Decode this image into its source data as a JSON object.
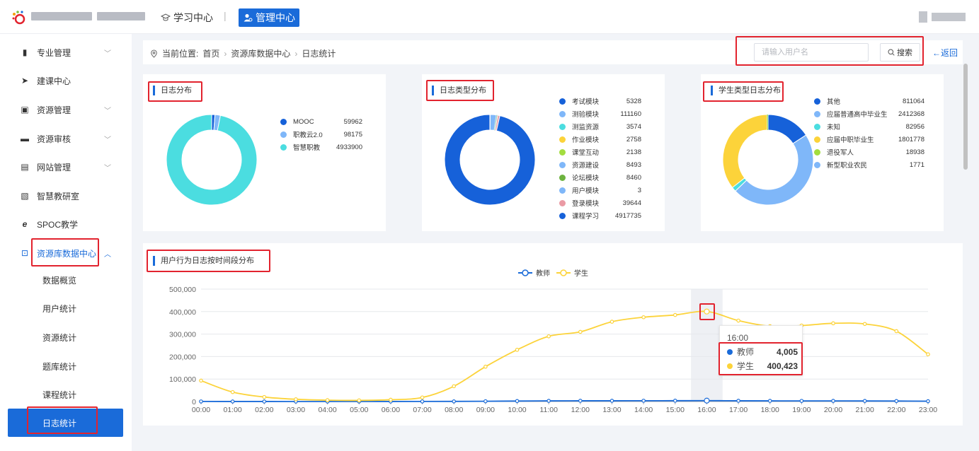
{
  "header": {
    "nav_study": "学习中心",
    "nav_admin": "管理中心"
  },
  "sidebar": {
    "items": [
      {
        "label": "专业管理",
        "icon": "book-icon",
        "expandable": true
      },
      {
        "label": "建课中心",
        "icon": "send-icon",
        "expandable": false
      },
      {
        "label": "资源管理",
        "icon": "box-icon",
        "expandable": true
      },
      {
        "label": "资源审核",
        "icon": "folder-icon",
        "expandable": true
      },
      {
        "label": "网站管理",
        "icon": "monitor-icon",
        "expandable": true
      },
      {
        "label": "智慧教研室",
        "icon": "document-icon",
        "expandable": false
      },
      {
        "label": "SPOC教学",
        "icon": "browser-icon",
        "expandable": false
      },
      {
        "label": "资源库数据中心",
        "icon": "data-icon",
        "expandable": true,
        "active": true
      }
    ],
    "sub_items": [
      {
        "label": "数据概览"
      },
      {
        "label": "用户统计"
      },
      {
        "label": "资源统计"
      },
      {
        "label": "题库统计"
      },
      {
        "label": "课程统计"
      },
      {
        "label": "日志统计",
        "active": true
      }
    ]
  },
  "breadcrumb": {
    "prefix": "当前位置:",
    "items": [
      "首页",
      "资源库数据中心",
      "日志统计"
    ]
  },
  "search": {
    "placeholder": "请输入用户名",
    "value": "",
    "button_label": "搜索"
  },
  "back_label": "←返回",
  "colors": {
    "accent": "#1a6bd9",
    "highlight_box": "#e2232e",
    "teacher": "#1a6bd9",
    "student": "#fcd33a"
  },
  "cards": {
    "log_dist": {
      "title": "日志分布",
      "items": [
        {
          "name": "MOOC",
          "value": "59962",
          "color": "#1661d9"
        },
        {
          "name": "职教云2.0",
          "value": "98175",
          "color": "#7fb7f9"
        },
        {
          "name": "智慧职教",
          "value": "4933900",
          "color": "#4bdde0"
        }
      ]
    },
    "log_type_dist": {
      "title": "日志类型分布",
      "items": [
        {
          "name": "考试模块",
          "value": "5328",
          "color": "#1661d9"
        },
        {
          "name": "测验模块",
          "value": "111160",
          "color": "#7fb7f9"
        },
        {
          "name": "测监资源",
          "value": "3574",
          "color": "#4bdde0"
        },
        {
          "name": "作业模块",
          "value": "2758",
          "color": "#fcd33a"
        },
        {
          "name": "课堂互动",
          "value": "2138",
          "color": "#a3dd3f"
        },
        {
          "name": "资源建设",
          "value": "8493",
          "color": "#7fb7f9"
        },
        {
          "name": "论坛模块",
          "value": "8460",
          "color": "#6db33f"
        },
        {
          "name": "用户模块",
          "value": "3",
          "color": "#7fb7f9"
        },
        {
          "name": "登录模块",
          "value": "39644",
          "color": "#ea9aa4"
        },
        {
          "name": "课程学习",
          "value": "4917735",
          "color": "#1661d9"
        }
      ]
    },
    "student_type_dist": {
      "title": "学生类型日志分布",
      "items": [
        {
          "name": "其他",
          "value": "811064",
          "color": "#1661d9"
        },
        {
          "name": "应届普通高中毕业生",
          "value": "2412368",
          "color": "#7fb7f9"
        },
        {
          "name": "未知",
          "value": "82956",
          "color": "#4bdde0"
        },
        {
          "name": "应届中职毕业生",
          "value": "1801778",
          "color": "#fcd33a"
        },
        {
          "name": "退役军人",
          "value": "18938",
          "color": "#a3dd3f"
        },
        {
          "name": "新型职业农民",
          "value": "1771",
          "color": "#7fb7f9"
        }
      ]
    }
  },
  "chart_data": {
    "type": "line",
    "title": "用户行为日志按时间段分布",
    "x": [
      "00:00",
      "01:00",
      "02:00",
      "03:00",
      "04:00",
      "05:00",
      "06:00",
      "07:00",
      "08:00",
      "09:00",
      "10:00",
      "11:00",
      "12:00",
      "13:00",
      "14:00",
      "15:00",
      "16:00",
      "17:00",
      "18:00",
      "19:00",
      "20:00",
      "21:00",
      "22:00",
      "23:00"
    ],
    "series": [
      {
        "name": "教师",
        "color": "#1a6bd9",
        "values": [
          300,
          200,
          150,
          100,
          100,
          100,
          150,
          300,
          600,
          1200,
          2200,
          3000,
          3300,
          3400,
          3500,
          3700,
          4005,
          3300,
          2900,
          2700,
          2800,
          2600,
          2200,
          1400
        ]
      },
      {
        "name": "学生",
        "color": "#fcd33a",
        "values": [
          93000,
          42000,
          20000,
          10000,
          6000,
          5000,
          8000,
          18000,
          68000,
          155000,
          230000,
          290000,
          310000,
          355000,
          375000,
          385000,
          400423,
          360000,
          335000,
          338000,
          348000,
          345000,
          313000,
          210000
        ]
      }
    ],
    "yticks": [
      "500,000",
      "400,000",
      "300,000",
      "200,000",
      "100,000",
      "0"
    ],
    "ylim": [
      0,
      500000
    ],
    "grid": true,
    "legend": "top-center",
    "tooltip": {
      "title": "16:00",
      "rows": [
        {
          "name": "教师",
          "value": "4,005"
        },
        {
          "name": "学生",
          "value": "400,423"
        }
      ]
    }
  }
}
